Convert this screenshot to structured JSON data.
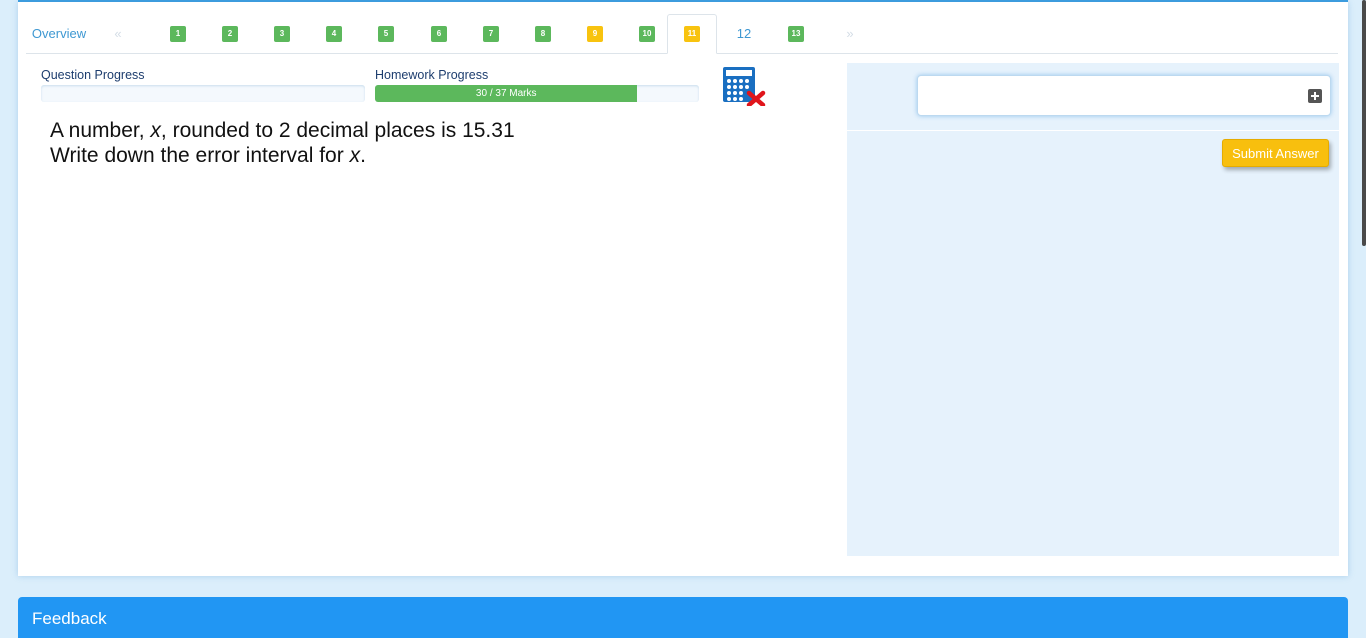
{
  "tabs": {
    "overview_label": "Overview",
    "prev_arrow": "«",
    "next_arrow": "»",
    "questions": [
      {
        "number": "1",
        "status": "complete"
      },
      {
        "number": "2",
        "status": "complete"
      },
      {
        "number": "3",
        "status": "complete"
      },
      {
        "number": "4",
        "status": "complete"
      },
      {
        "number": "5",
        "status": "complete"
      },
      {
        "number": "6",
        "status": "complete"
      },
      {
        "number": "7",
        "status": "complete"
      },
      {
        "number": "8",
        "status": "complete"
      },
      {
        "number": "9",
        "status": "partial"
      },
      {
        "number": "10",
        "status": "complete"
      },
      {
        "number": "11",
        "status": "partial",
        "active": true
      },
      {
        "number": "12",
        "status": "unattempted"
      },
      {
        "number": "13",
        "status": "complete"
      }
    ]
  },
  "progress": {
    "question_label": "Question Progress",
    "question_fraction": 0,
    "homework_label": "Homework Progress",
    "homework_text": "30 / 37 Marks",
    "homework_fraction": 0.81
  },
  "calculator": {
    "icon": "calculator-not-allowed-icon"
  },
  "question": {
    "line1_a": "A number, ",
    "line1_var": "x",
    "line1_b": ", rounded to 2 decimal places is 15.31",
    "line2_a": "Write down the error interval for ",
    "line2_var": "x",
    "line2_b": "."
  },
  "answer": {
    "input_value": "",
    "submit_label": "Submit Answer"
  },
  "feedback": {
    "title": "Feedback"
  },
  "colors": {
    "complete": "#5cb85c",
    "partial": "#f8c30f",
    "link": "#3e98d2",
    "feedback_bar": "#2196f3"
  }
}
